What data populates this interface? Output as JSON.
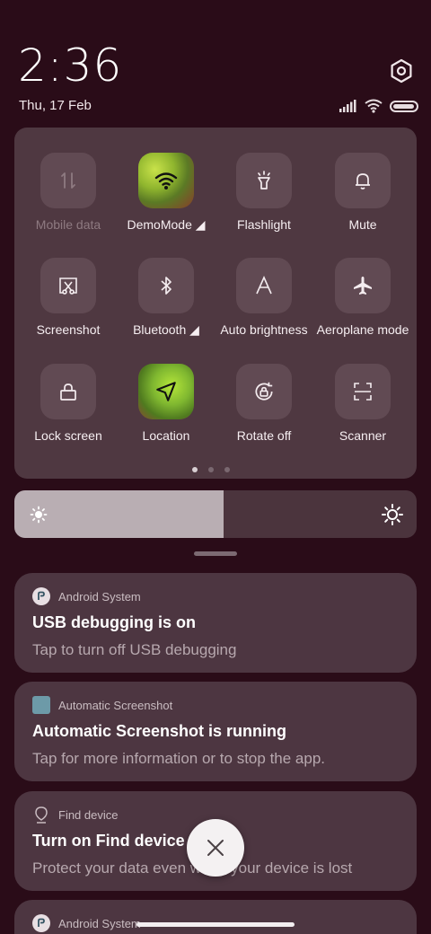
{
  "status": {
    "time": "2:36",
    "date": "Thu, 17 Feb"
  },
  "quick_tiles": [
    {
      "label": "Mobile data",
      "icon": "mobile-data-icon",
      "state": "disabled"
    },
    {
      "label": "DemoMode ◢",
      "icon": "wifi-icon",
      "state": "active"
    },
    {
      "label": "Flashlight",
      "icon": "flashlight-icon",
      "state": "off"
    },
    {
      "label": "Mute",
      "icon": "bell-icon",
      "state": "off"
    },
    {
      "label": "Screenshot",
      "icon": "screenshot-scissors-icon",
      "state": "off"
    },
    {
      "label": "Bluetooth ◢",
      "icon": "bluetooth-icon",
      "state": "off"
    },
    {
      "label": "Auto brightness",
      "icon": "auto-brightness-icon",
      "state": "off"
    },
    {
      "label": "Aeroplane mode",
      "icon": "airplane-icon",
      "state": "off"
    },
    {
      "label": "Lock screen",
      "icon": "lock-icon",
      "state": "off"
    },
    {
      "label": "Location",
      "icon": "location-arrow-icon",
      "state": "active"
    },
    {
      "label": "Rotate off",
      "icon": "rotate-lock-icon",
      "state": "off"
    },
    {
      "label": "Scanner",
      "icon": "scanner-icon",
      "state": "off"
    }
  ],
  "pager": {
    "pages": 3,
    "current": 1
  },
  "brightness": {
    "level": 0.52
  },
  "notifications": [
    {
      "app": "Android System",
      "title": "USB debugging is on",
      "text": "Tap to turn off USB debugging"
    },
    {
      "app": "Automatic Screenshot",
      "title": "Automatic Screenshot is running",
      "text": "Tap for more information or to stop the app."
    },
    {
      "app": "Find device",
      "title": "Turn on Find device",
      "text": "Protect your data even when your device is lost"
    },
    {
      "app": "Android System"
    }
  ],
  "colors": {
    "background": "#2a0c18",
    "panel": "#4f3841",
    "tile": "#614a53",
    "notification": "#4d3641"
  }
}
